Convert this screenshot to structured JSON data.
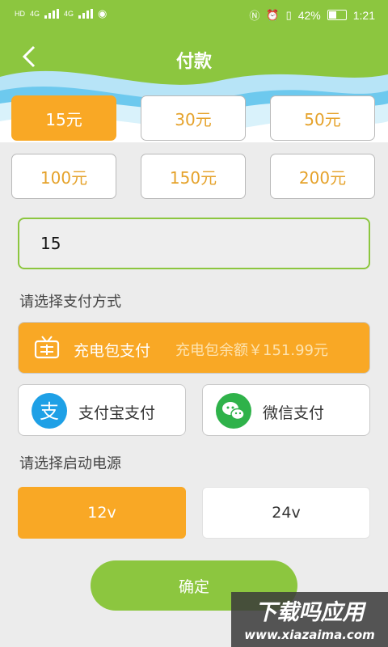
{
  "status_bar": {
    "left_sim1": "HD",
    "left_sim2": "HD",
    "net1": "4G",
    "net2": "4G",
    "battery": "42%",
    "time": "1:21"
  },
  "header": {
    "back_icon": "chevron-left",
    "title": "付款"
  },
  "amounts": [
    {
      "label": "15元",
      "selected": true
    },
    {
      "label": "30元",
      "selected": false
    },
    {
      "label": "50元",
      "selected": false
    },
    {
      "label": "100元",
      "selected": false
    },
    {
      "label": "150元",
      "selected": false
    },
    {
      "label": "200元",
      "selected": false
    }
  ],
  "amount_input": {
    "value": "15"
  },
  "payment": {
    "section_title": "请选择支付方式",
    "wallet": {
      "label": "充电包支付",
      "balance": "充电包余额￥151.99元",
      "icon": "tv-wallet-icon"
    },
    "alipay": {
      "label": "支付宝支付",
      "icon": "alipay-icon"
    },
    "wechat": {
      "label": "微信支付",
      "icon": "wechat-icon"
    }
  },
  "power": {
    "section_title": "请选择启动电源",
    "options": [
      {
        "label": "12v",
        "selected": true
      },
      {
        "label": "24v",
        "selected": false
      }
    ]
  },
  "confirm": {
    "label": "确定"
  },
  "watermark": {
    "main": "下载吗应用",
    "url": "www.xiazaima.com"
  },
  "colors": {
    "accent_green": "#8cc63f",
    "accent_orange": "#f9a825",
    "amount_text": "#e5a22a",
    "background": "#ececec"
  }
}
